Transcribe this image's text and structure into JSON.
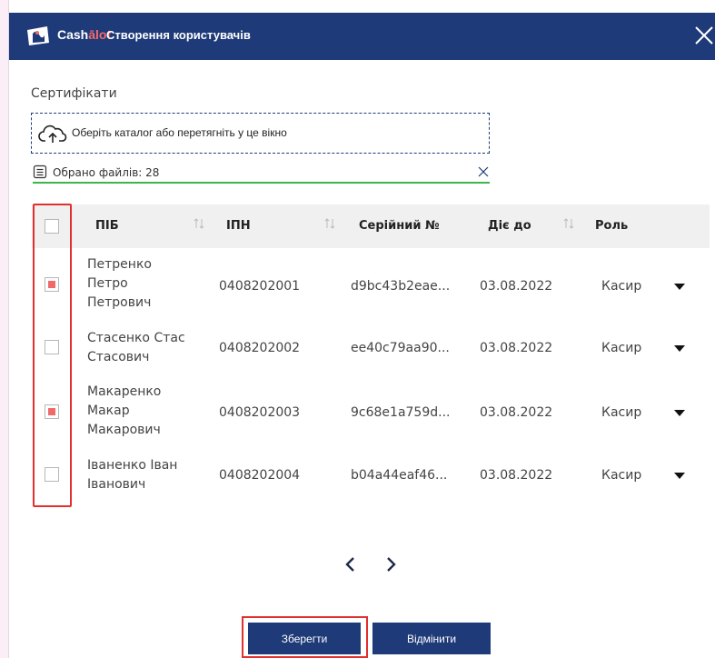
{
  "header": {
    "brand_part1": "Cash",
    "brand_part2": "ālot",
    "title": "Створення користувачів"
  },
  "certificates": {
    "label": "Сертифікати",
    "dropzone_text": "Оберіть каталог або перетягніть у це вікно",
    "files_selected": "Обрано файлів: 28"
  },
  "table": {
    "columns": {
      "name": "ПІБ",
      "ipn": "ІПН",
      "serial": "Серійний №",
      "valid_until": "Діє до",
      "role": "Роль"
    },
    "rows": [
      {
        "name_lines": [
          "Петренко",
          "Петро",
          "Петрович"
        ],
        "ipn": "0408202001",
        "serial": "d9bc43b2eae...",
        "valid_until": "03.08.2022",
        "role": "Касир",
        "checked": true
      },
      {
        "name_lines": [
          "Стасенко Стас",
          "Стасович"
        ],
        "ipn": "0408202002",
        "serial": "ee40c79aa90...",
        "valid_until": "03.08.2022",
        "role": "Касир",
        "checked": false
      },
      {
        "name_lines": [
          "Макаренко",
          "Макар",
          "Макарович"
        ],
        "ipn": "0408202003",
        "serial": "9c68e1a759d...",
        "valid_until": "03.08.2022",
        "role": "Касир",
        "checked": true
      },
      {
        "name_lines": [
          "Іваненко Іван",
          "Іванович"
        ],
        "ipn": "0408202004",
        "serial": "b04a44eaf46...",
        "valid_until": "03.08.2022",
        "role": "Касир",
        "checked": false
      }
    ]
  },
  "buttons": {
    "save": "Зберегти",
    "cancel": "Відмінити"
  },
  "colors": {
    "primary": "#1e3a78",
    "accent": "#f16a6a",
    "highlight": "#e0312f",
    "success": "#3cb54a"
  }
}
